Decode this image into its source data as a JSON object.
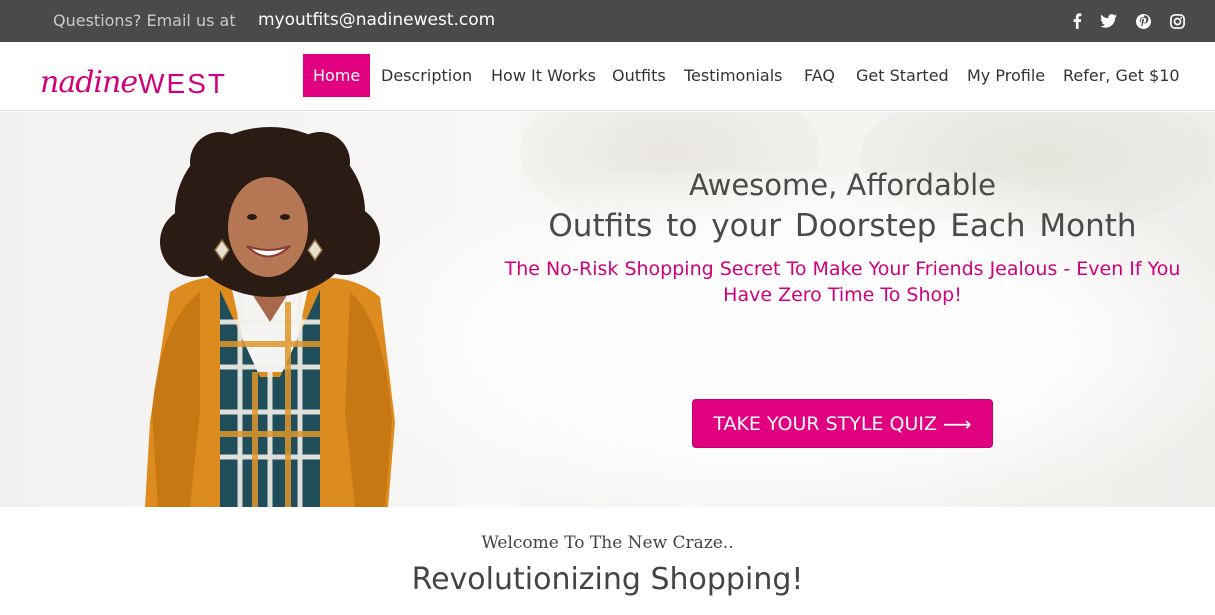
{
  "topbar": {
    "question": "Questions? Email us at",
    "email": "myoutfits@nadinewest.com",
    "social": [
      "facebook-icon",
      "twitter-icon",
      "pinterest-icon",
      "instagram-icon"
    ]
  },
  "logo": {
    "script": "nadine",
    "bold": "WEST"
  },
  "nav": {
    "home": "Home",
    "description": "Description",
    "how_it_works": "How It Works",
    "outfits": "Outfits",
    "testimonials": "Testimonials",
    "faq": "FAQ",
    "get_started": "Get Started",
    "my_profile": "My Profile",
    "refer": "Refer, Get $10"
  },
  "hero": {
    "title_line1": "Awesome, Affordable",
    "title_line2": "Outfits to your Doorstep Each Month",
    "subtitle": "The No-Risk Shopping Secret To Make Your Friends Jealous - Even If You Have Zero Time To Shop!",
    "cta_label": "TAKE YOUR STYLE QUIZ",
    "cta_arrow": "⟶"
  },
  "section": {
    "welcome": "Welcome To The New Craze..",
    "heading": "Revolutionizing Shopping!"
  },
  "colors": {
    "brand": "#e1007f",
    "topbar_bg": "#4a4a4a",
    "text": "#4a4a4a"
  }
}
